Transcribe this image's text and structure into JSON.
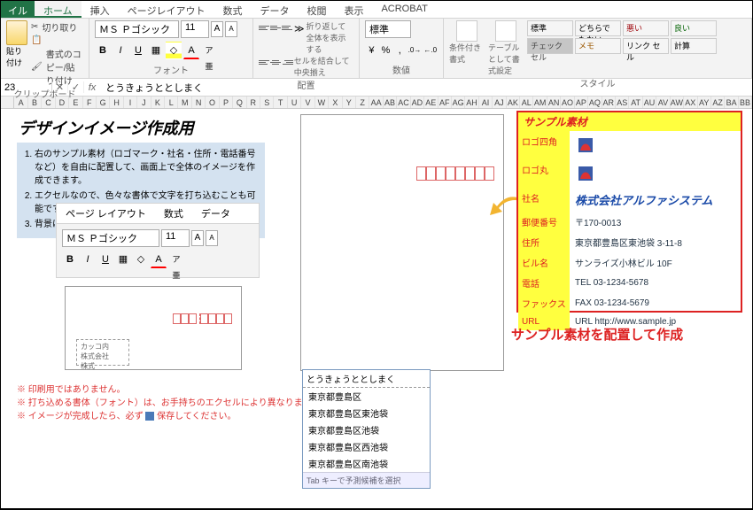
{
  "ribbon": {
    "file": "イル",
    "tabs": [
      "ホーム",
      "挿入",
      "ページレイアウト",
      "数式",
      "データ",
      "校閲",
      "表示",
      "ACROBAT"
    ],
    "active_tab": "ホーム",
    "clipboard": {
      "cut": "切り取り",
      "copy": "書式のコピー/貼り付け",
      "paste": "貼り付け",
      "label": "クリップボード"
    },
    "font": {
      "name": "ＭＳ Ｐゴシック",
      "size": "11",
      "label": "フォント",
      "btns": {
        "b": "B",
        "i": "I",
        "u": "U"
      }
    },
    "align": {
      "label": "配置",
      "wrap": "折り返して全体を表示する",
      "merge": "セルを結合して中央揃え"
    },
    "number": {
      "label": "数値",
      "format": "標準"
    },
    "styles": {
      "label": "スタイル",
      "cond": "条件付き書式",
      "table": "テーブルとして書式設定",
      "chips": [
        "標準",
        "どちらでもない",
        "悪い",
        "良い",
        "チェック セル",
        "メモ",
        "リンク セル",
        "計算"
      ]
    }
  },
  "formula_bar": {
    "cell": "23",
    "value": "とうきょうととしまく"
  },
  "columns": [
    "A",
    "B",
    "C",
    "D",
    "E",
    "F",
    "G",
    "H",
    "I",
    "J",
    "K",
    "L",
    "M",
    "N",
    "O",
    "P",
    "Q",
    "R",
    "S",
    "T",
    "U",
    "V",
    "W",
    "X",
    "Y",
    "Z",
    "AA",
    "AB",
    "AC",
    "AD",
    "AE",
    "AF",
    "AG",
    "AH",
    "AI",
    "AJ",
    "AK",
    "AL",
    "AM",
    "AN",
    "AO",
    "AP",
    "AQ",
    "AR",
    "AS",
    "AT",
    "AU",
    "AV",
    "AW",
    "AX",
    "AY",
    "AZ",
    "BA",
    "BB"
  ],
  "sheet": {
    "title": "デザインイメージ作成用",
    "instructions": [
      "右のサンプル素材（ロゴマーク・社名・住所・電話番号など）を自由に配置して、画面上で全体のイメージを作成できます。",
      "エクセルなので、色々な書体で文字を打ち込むことも可能です。",
      "背景に色をつけたり、線を引くこともできます。"
    ],
    "mini_tabs": [
      "ページ レイアウト",
      "数式",
      "データ"
    ],
    "small_addr": [
      "カッコ内",
      "株式会社",
      "株式"
    ],
    "notes": [
      "印刷用ではありません。",
      "打ち込める書体（フォント）は、お手持ちのエクセルにより異なります。",
      "イメージが完成したら、必ず"
    ],
    "notes_save": "保存してください。",
    "ime": {
      "head": "とうきょうととしまく",
      "candidates": [
        "東京都豊島区",
        "東京都豊島区東池袋",
        "東京都豊島区池袋",
        "東京都豊島区西池袋",
        "東京都豊島区南池袋"
      ],
      "hint": "Tab キーで予測候補を選択"
    },
    "sample": {
      "header": "サンプル素材",
      "rows": [
        {
          "label": "ロゴ四角",
          "type": "logo-sq"
        },
        {
          "label": "ロゴ丸",
          "type": "logo-rd"
        },
        {
          "label": "社名",
          "value": "株式会社アルファシステム",
          "type": "company"
        },
        {
          "label": "郵便番号",
          "value": "〒170-0013"
        },
        {
          "label": "住所",
          "value": "東京都豊島区東池袋 3-11-8"
        },
        {
          "label": "ビル名",
          "value": "サンライズ小林ビル 10F"
        },
        {
          "label": "電話",
          "value": "TEL 03-1234-5678"
        },
        {
          "label": "ファックス",
          "value": "FAX 03-1234-5679"
        },
        {
          "label": "URL",
          "value": "URL http://www.sample.jp"
        }
      ],
      "caption": "サンプル素材を配置して作成"
    }
  }
}
